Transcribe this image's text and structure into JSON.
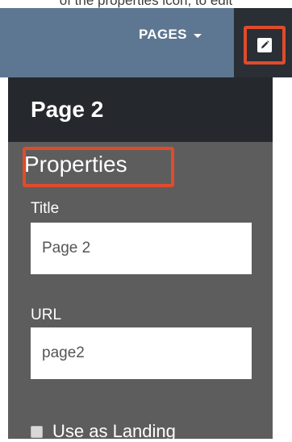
{
  "caption": "of the properties icon, to edit",
  "topbar": {
    "menu_label": "PAGES"
  },
  "edit_button": {
    "icon": "edit-icon"
  },
  "panel": {
    "page_title": "Page 2",
    "section_label": "Properties",
    "fields": [
      {
        "label": "Title",
        "value": "Page 2"
      },
      {
        "label": "URL",
        "value": "page2"
      }
    ],
    "checkbox": {
      "label": "Use as Landing",
      "checked": false
    }
  },
  "colors": {
    "topbar": "#5d7691",
    "panel_header": "#25282c",
    "panel_body": "#5d5d5d",
    "highlight": "#e04b2c"
  }
}
